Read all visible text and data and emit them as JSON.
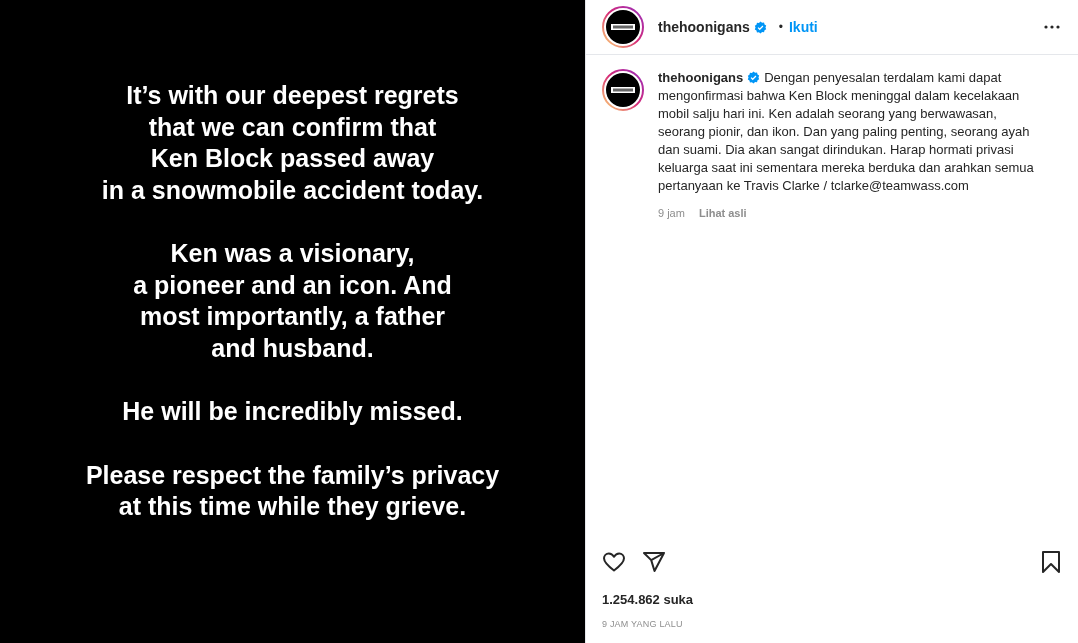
{
  "post_image": {
    "paragraphs": [
      [
        "It’s with our deepest regrets",
        "that we can confirm that",
        "Ken Block passed away",
        "in a snowmobile accident today."
      ],
      [
        "Ken was a visionary,",
        "a pioneer and an icon. And",
        "most importantly, a father",
        "and husband."
      ],
      [
        "He will be incredibly missed."
      ],
      [
        "Please respect the family’s privacy",
        "at this time while they grieve."
      ]
    ]
  },
  "header": {
    "username": "thehoonigans",
    "verified": true,
    "separator": "•",
    "follow": "Ikuti"
  },
  "caption": {
    "username": "thehoonigans",
    "verified": true,
    "text": "Dengan penyesalan terdalam kami dapat mengonfirmasi bahwa Ken Block meninggal dalam kecelakaan mobil salju hari ini. Ken adalah seorang yang berwawasan, seorang pionir, dan ikon. Dan yang paling penting, seorang ayah dan suami. Dia akan sangat dirindukan. Harap hormati privasi keluarga saat ini sementara mereka berduka dan arahkan semua pertanyaan ke Travis Clarke / tclarke@teamwass.com",
    "time": "9 jam",
    "translate": "Lihat asli"
  },
  "actions": {
    "liked": false,
    "saved": false
  },
  "likes": "1.254.862 suka",
  "timestamp": "9 JAM YANG LALU"
}
